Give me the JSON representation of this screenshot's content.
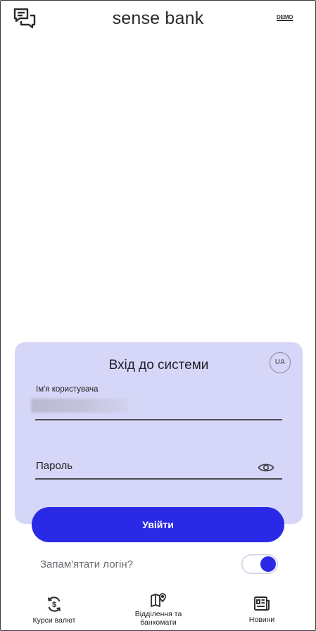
{
  "header": {
    "brand": "sense bank",
    "demo_label": "DEMO"
  },
  "login": {
    "title": "Вхід до системи",
    "language": "UA",
    "username_label": "Ім'я користувача",
    "password_label": "Пароль",
    "submit_label": "Увійти",
    "remember_label": "Запам'ятати логін?",
    "remember_enabled": true
  },
  "bottom_nav": {
    "items": [
      {
        "label": "Курси валют",
        "icon": "currency-exchange-icon"
      },
      {
        "label_line1": "Відділення та",
        "label_line2": "банкомати",
        "icon": "map-pin-icon"
      },
      {
        "label": "Новини",
        "icon": "news-icon"
      }
    ]
  },
  "colors": {
    "accent": "#2a2ae6",
    "panel_bg": "#d6d7f8"
  }
}
